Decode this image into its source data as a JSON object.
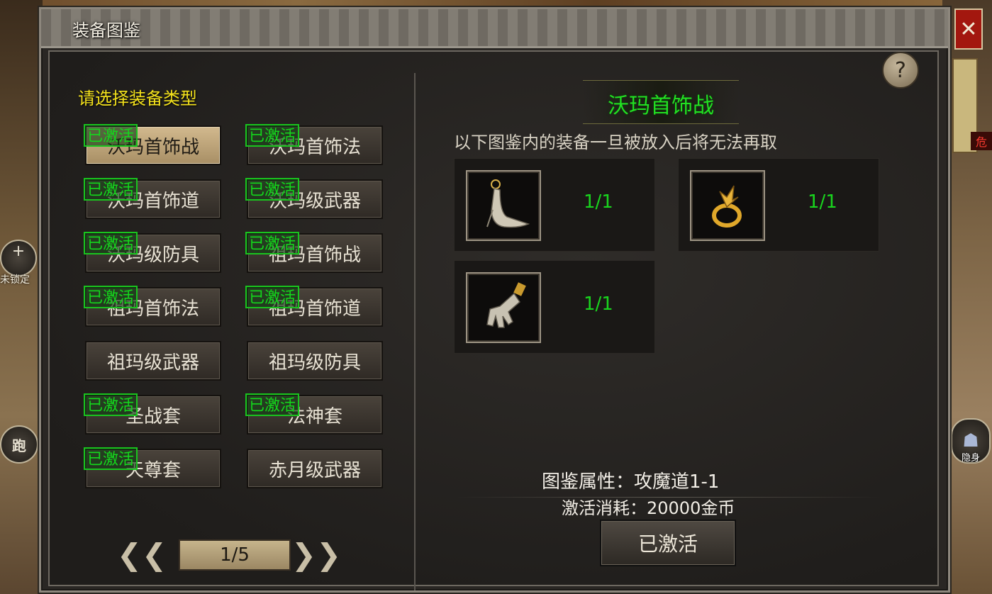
{
  "window": {
    "title": "装备图鉴",
    "close_glyph": "✕",
    "help_glyph": "?"
  },
  "left_panel": {
    "heading": "请选择装备类型",
    "buttons": [
      {
        "label": "沃玛首饰战",
        "badge": "已激活",
        "selected": true
      },
      {
        "label": "沃玛首饰法",
        "badge": "已激活"
      },
      {
        "label": "沃玛首饰道",
        "badge": "已激活"
      },
      {
        "label": "沃玛级武器",
        "badge": "已激活"
      },
      {
        "label": "沃玛级防具",
        "badge": "已激活"
      },
      {
        "label": "祖玛首饰战",
        "badge": "已激活"
      },
      {
        "label": "祖玛首饰法",
        "badge": "已激活"
      },
      {
        "label": "祖玛首饰道",
        "badge": "已激活"
      },
      {
        "label": "祖玛级武器",
        "badge": ""
      },
      {
        "label": "祖玛级防具",
        "badge": ""
      },
      {
        "label": "圣战套",
        "badge": "已激活"
      },
      {
        "label": "法神套",
        "badge": "已激活"
      },
      {
        "label": "天尊套",
        "badge": "已激活"
      },
      {
        "label": "赤月级武器",
        "badge": ""
      }
    ],
    "pager": {
      "prev_glyph": "❮❮",
      "next_glyph": "❯❯",
      "page": "1/5"
    }
  },
  "right_panel": {
    "set_name": "沃玛首饰战",
    "warning": "以下图鉴内的装备一旦被放入后将无法再取",
    "items": [
      {
        "icon": "necklace-icon",
        "count": "1/1"
      },
      {
        "icon": "ring-icon",
        "count": "1/1"
      },
      {
        "icon": "bracelet-icon",
        "count": "1/1"
      }
    ],
    "attribute": "图鉴属性：攻魔道1-1",
    "cost": "激活消耗：20000金币",
    "activate_label": "已激活"
  },
  "hud": {
    "lock_label": "未锁定",
    "lock_plus": "+",
    "run_label": "跑",
    "stealth_label": "隐身",
    "danger_label": "危"
  },
  "colors": {
    "activated_green": "#14d81c",
    "heading_yellow": "#f4e21c",
    "close_red": "#a3170f"
  }
}
